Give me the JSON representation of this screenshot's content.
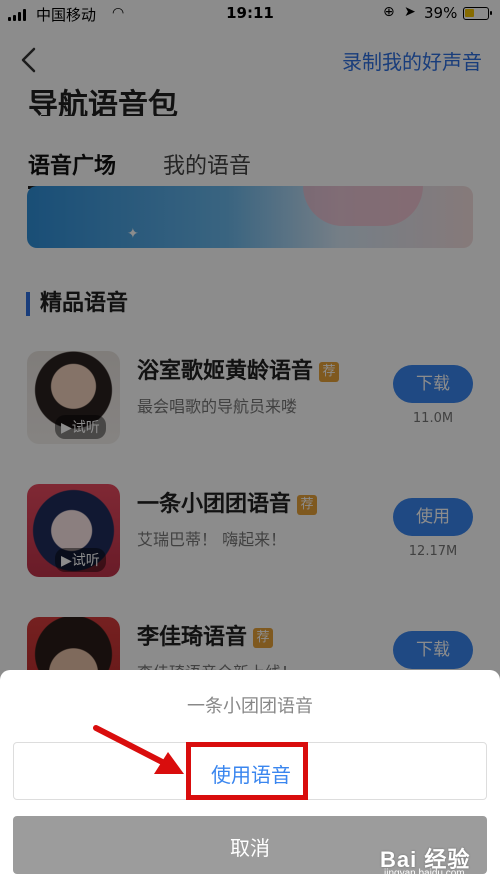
{
  "status_bar": {
    "carrier": "中国移动",
    "time": "19:11",
    "battery": "39%",
    "battery_level": 0.39
  },
  "header": {
    "record_link": "录制我的好声音"
  },
  "page": {
    "title": "导航语音包",
    "tabs": [
      {
        "label": "语音广场",
        "active": true
      },
      {
        "label": "我的语音",
        "active": false
      }
    ],
    "section_title": "精品语音"
  },
  "voices": [
    {
      "name": "浴室歌姬黄龄语音",
      "badge": "荐",
      "desc": "最会唱歌的导航员来喽",
      "action": "下载",
      "size": "11.0M",
      "preview": "▶试听"
    },
    {
      "name": "一条小团团语音",
      "badge": "荐",
      "desc": "艾瑞巴蒂！ 嗨起来！",
      "action": "使用",
      "size": "12.17M",
      "preview": "▶试听"
    },
    {
      "name": "李佳琦语音",
      "badge": "荐",
      "desc": "李佳琦语音全新上线！",
      "action": "下载",
      "size": "",
      "preview": ""
    }
  ],
  "action_sheet": {
    "title": "一条小团团语音",
    "use_label": "使用语音",
    "cancel_label": "取消"
  },
  "watermark": {
    "main": "Bai 经验",
    "sub": "jingyan.baidu.com"
  },
  "colors": {
    "accent": "#3a86ef",
    "highlight": "#d90d0d",
    "badge": "#e8a23a"
  }
}
